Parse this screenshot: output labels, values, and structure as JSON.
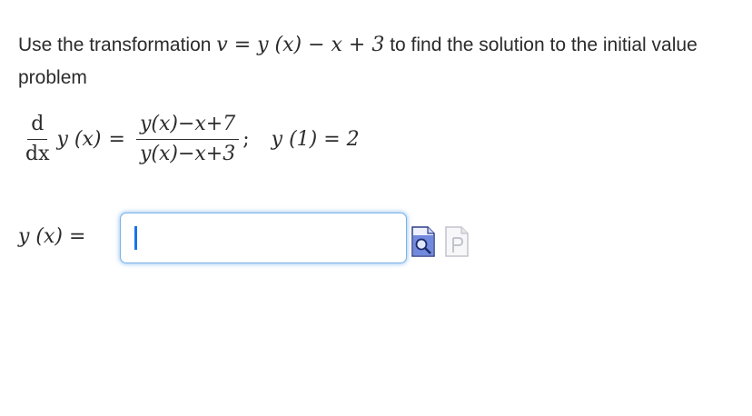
{
  "question": {
    "text_before": "Use the transformation ",
    "transformation": "v = y (x) − x + 3",
    "text_after": " to find the solution to the initial value problem"
  },
  "equation": {
    "derivative_num": "d",
    "derivative_den": "dx",
    "lhs_function": "y (x)",
    "equals": "=",
    "rhs_numerator": "y(x)−x+7",
    "rhs_denominator": "y(x)−x+3",
    "separator": ";",
    "initial_condition": "y (1) = 2"
  },
  "answer": {
    "label": "y (x) =",
    "value": ""
  },
  "tools": {
    "preview_icon": "preview-magnifier-icon",
    "palette_icon": "equation-palette-icon"
  },
  "colors": {
    "text": "#2b2b2b",
    "input_border": "#7ab2e8",
    "input_glow": "#5aa0eb",
    "caret": "#1a73e8",
    "icon_blue": "#3d5fd0",
    "icon_gray": "#c8c8d0"
  }
}
